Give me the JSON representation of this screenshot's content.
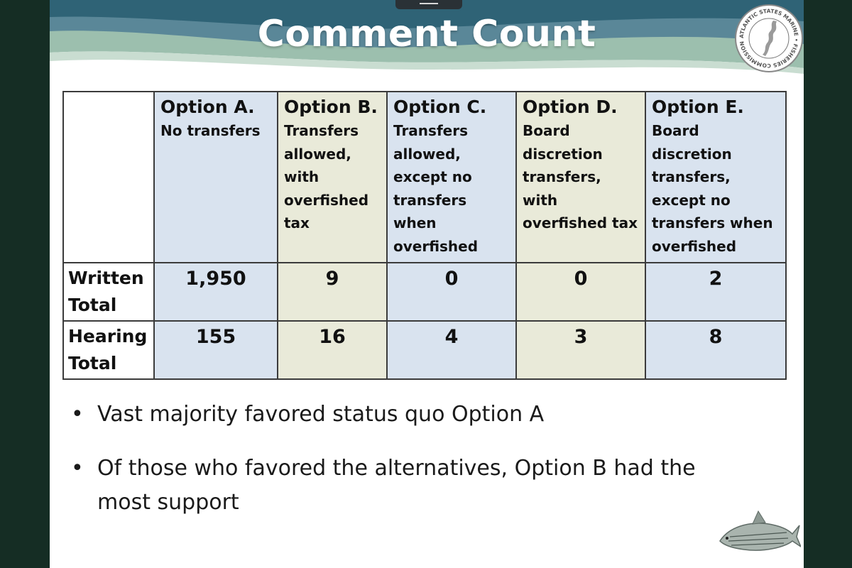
{
  "slide": {
    "title": "Comment Count",
    "seal_text": "ATLANTIC STATES MARINE FISHERIES COMMISSION"
  },
  "table": {
    "columns": [
      {
        "title": "Option A.",
        "desc": "No transfers",
        "color": "#d9e3ef"
      },
      {
        "title": "Option B.",
        "desc": "Transfers allowed, with overfished tax",
        "color": "#e9ead9"
      },
      {
        "title": "Option C.",
        "desc": "Transfers allowed, except no transfers when overfished",
        "color": "#d9e3ef"
      },
      {
        "title": "Option D.",
        "desc": "Board discretion transfers, with overfished tax",
        "color": "#e9ead9"
      },
      {
        "title": "Option E.",
        "desc": "Board discretion transfers, except no transfers when overfished",
        "color": "#d9e3ef"
      }
    ],
    "rows": [
      {
        "label_line1": "Written",
        "label_line2": "Total",
        "values": [
          "1,950",
          "9",
          "0",
          "0",
          "2"
        ]
      },
      {
        "label_line1": "Hearing",
        "label_line2": "Total",
        "values": [
          "155",
          "16",
          "4",
          "3",
          "8"
        ]
      }
    ]
  },
  "bullets": [
    {
      "marker": "•",
      "text": "Vast majority favored status quo Option A"
    },
    {
      "marker": "•",
      "text": "Of those who favored the alternatives, Option B had the most support"
    }
  ]
}
